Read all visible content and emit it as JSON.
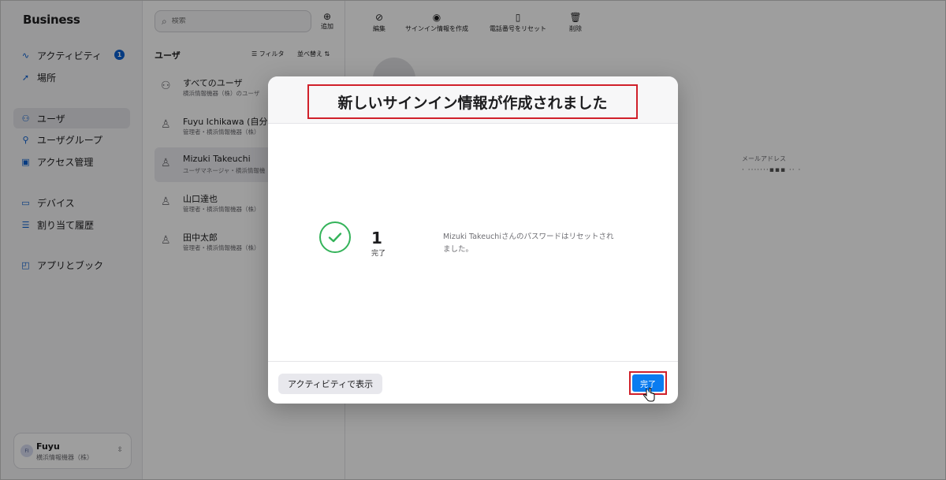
{
  "sidebar": {
    "brand": "Business",
    "items": [
      {
        "label": "アクティビティ",
        "icon": "activity-icon",
        "badge": "1"
      },
      {
        "label": "場所",
        "icon": "location-icon"
      },
      {
        "label": "ユーザ",
        "icon": "users-icon",
        "active": true
      },
      {
        "label": "ユーザグループ",
        "icon": "user-group-icon"
      },
      {
        "label": "アクセス管理",
        "icon": "access-card-icon"
      },
      {
        "label": "デバイス",
        "icon": "laptop-icon"
      },
      {
        "label": "割り当て履歴",
        "icon": "history-icon"
      },
      {
        "label": "アプリとブック",
        "icon": "app-icon"
      }
    ],
    "account": {
      "initials": "FI",
      "name": "Fuyu",
      "org": "横浜情報機器（株）"
    }
  },
  "users": {
    "search_placeholder": "検索",
    "add_label": "追加",
    "heading": "ユーザ",
    "filter_label": "フィルタ",
    "sort_label": "並べ替え",
    "rows": [
      {
        "name": "すべてのユーザ",
        "sub": "横浜情報機器（株）のユーザ"
      },
      {
        "name": "Fuyu Ichikawa (自分)",
        "sub": "管理者・横浜情報機器（株）"
      },
      {
        "name": "Mizuki Takeuchi",
        "sub": "ユーザマネージャ・横浜情報機",
        "selected": true
      },
      {
        "name": "山口達也",
        "sub": "管理者・横浜情報機器（株）"
      },
      {
        "name": "田中太郎",
        "sub": "管理者・横浜情報機器（株）"
      }
    ]
  },
  "toolbar": {
    "edit": "編集",
    "create_signin": "サインイン情報を作成",
    "reset_phone": "電話番号をリセット",
    "delete": "削除"
  },
  "detail": {
    "email_label": "メールアドレス",
    "email_value": "· ·······▪▪▪ ·· ·"
  },
  "modal": {
    "title": "新しいサインイン情報が作成されました",
    "count": "1",
    "count_label": "完了",
    "message": "Mizuki Takeuchiさんのパスワードはリセットされました。",
    "activity_button": "アクティビティで表示",
    "done_button": "完了"
  },
  "colors": {
    "accent": "#0a7cf0",
    "success": "#34b35a",
    "highlight": "#d0202a"
  }
}
